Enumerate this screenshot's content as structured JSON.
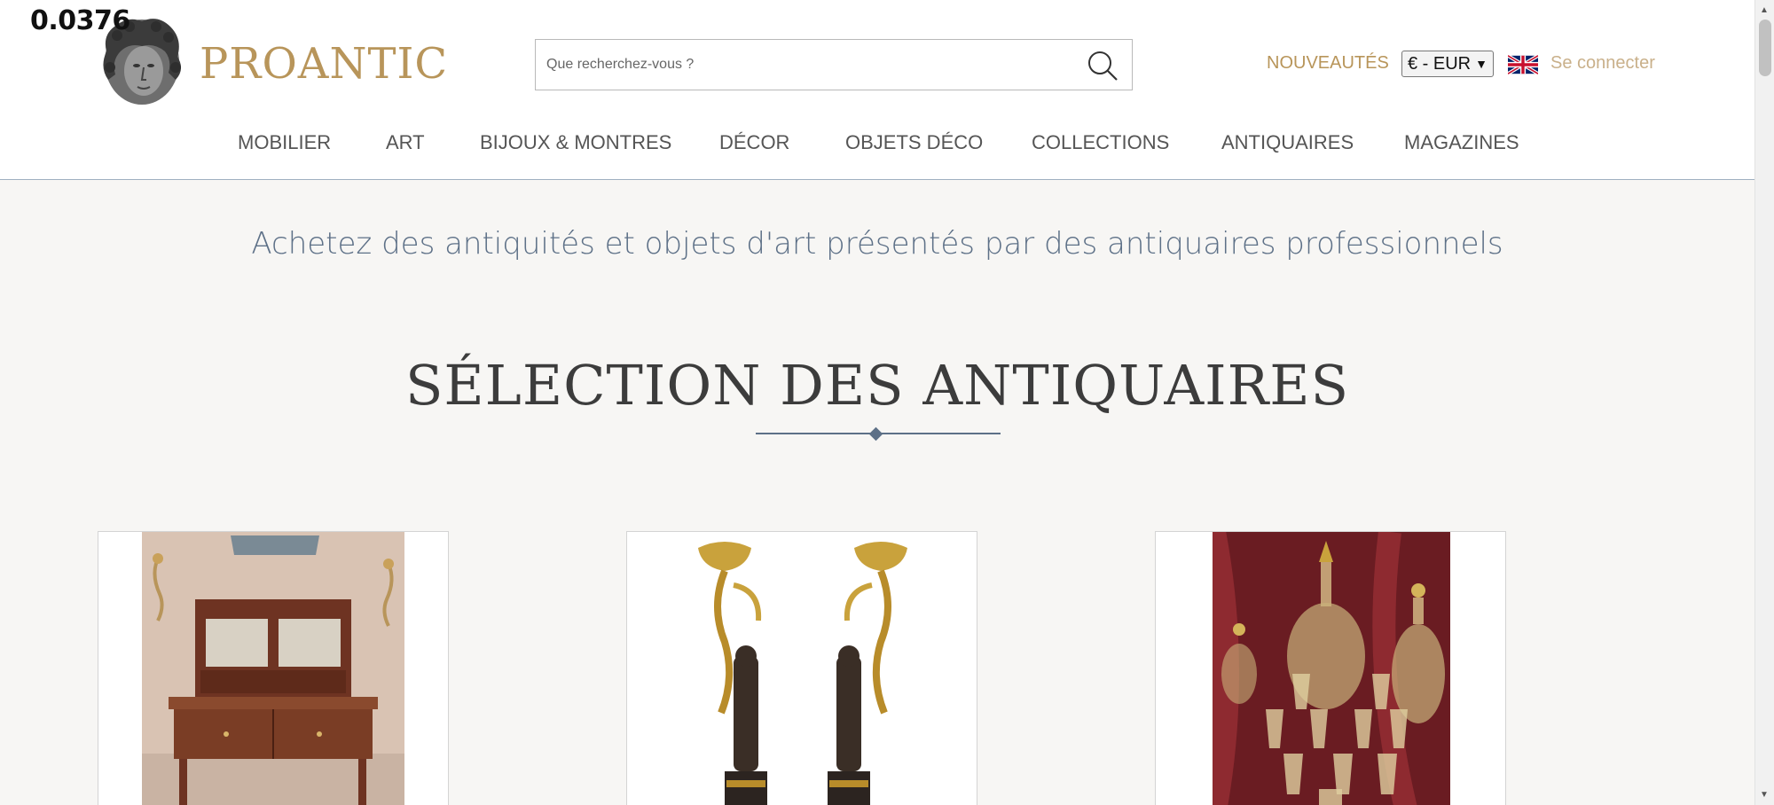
{
  "overlay": {
    "value": "0.0376"
  },
  "header": {
    "logo_text": "PROANTIC",
    "search": {
      "placeholder": "Que recherchez-vous ?"
    },
    "nouveautes": "NOUVEAUTÉS",
    "currency": "€ - EUR",
    "login": "Se connecter"
  },
  "nav": {
    "items": [
      {
        "label": "MOBILIER"
      },
      {
        "label": "ART"
      },
      {
        "label": "BIJOUX & MONTRES"
      },
      {
        "label": "DÉCOR"
      },
      {
        "label": "OBJETS DÉCO"
      },
      {
        "label": "COLLECTIONS"
      },
      {
        "label": "ANTIQUAIRES"
      },
      {
        "label": "MAGAZINES"
      }
    ]
  },
  "tagline": "Achetez des antiquités et objets d'art présentés par des antiquaires professionnels",
  "section": {
    "title": "SÉLECTION DES ANTIQUAIRES"
  },
  "colors": {
    "gold": "#b8955a",
    "slate": "#5d7087",
    "background": "#f7f6f4"
  },
  "icons": {
    "search": "search-icon",
    "flag": "uk-flag-icon"
  }
}
